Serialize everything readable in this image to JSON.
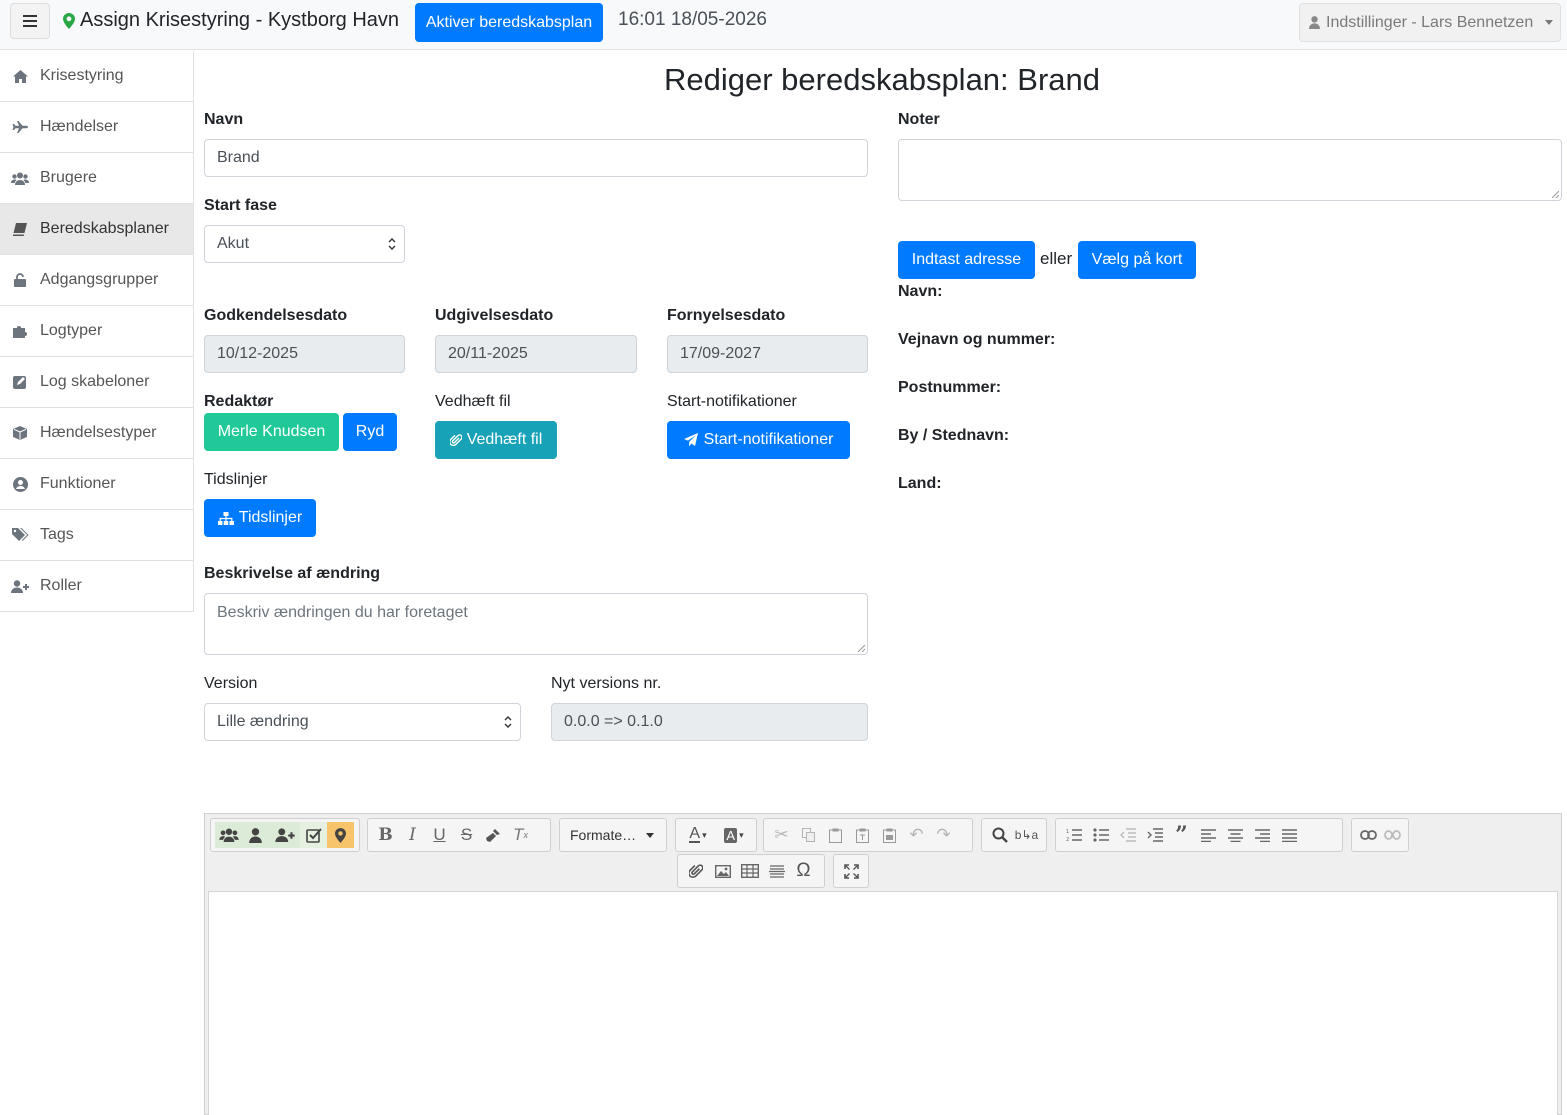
{
  "header": {
    "app_title": "Assign Krisestyring - Kystborg Havn",
    "activate_button": "Aktiver beredskabsplan",
    "datetime": "16:01 18/05-2026",
    "settings_label": "Indstillinger - Lars Bennetzen"
  },
  "sidebar": {
    "items": [
      {
        "label": "Krisestyring",
        "icon": "home-icon"
      },
      {
        "label": "Hændelser",
        "icon": "plane-icon"
      },
      {
        "label": "Brugere",
        "icon": "users-icon"
      },
      {
        "label": "Beredskabsplaner",
        "icon": "book-icon",
        "active": true
      },
      {
        "label": "Adgangsgrupper",
        "icon": "unlock-icon"
      },
      {
        "label": "Logtyper",
        "icon": "puzzle-icon"
      },
      {
        "label": "Log skabeloner",
        "icon": "edit-icon"
      },
      {
        "label": "Hændelsestyper",
        "icon": "cube-icon"
      },
      {
        "label": "Funktioner",
        "icon": "user-circle-icon"
      },
      {
        "label": "Tags",
        "icon": "tags-icon"
      },
      {
        "label": "Roller",
        "icon": "user-plus-icon"
      }
    ]
  },
  "page": {
    "title": "Rediger beredskabsplan: Brand"
  },
  "form": {
    "name_label": "Navn",
    "name_value": "Brand",
    "start_phase_label": "Start fase",
    "start_phase_value": "Akut",
    "approval_label": "Godkendelsesdato",
    "approval_value": "10/12-2025",
    "release_label": "Udgivelsesdato",
    "release_value": "20/11-2025",
    "renewal_label": "Fornyelsesdato",
    "renewal_value": "17/09-2027",
    "editor_label": "Redaktør",
    "editor_name": "Merle Knudsen",
    "clear_button": "Ryd",
    "attach_label": "Vedhæft fil",
    "attach_button": "Vedhæft fil",
    "notif_label": "Start-notifikationer",
    "notif_button": "Start-notifikationer",
    "timelines_label": "Tidslinjer",
    "timelines_button": "Tidslinjer",
    "change_label": "Beskrivelse af ændring",
    "change_placeholder": "Beskriv ændringen du har foretaget",
    "version_label": "Version",
    "version_value": "Lille ændring",
    "new_version_label": "Nyt versions nr.",
    "new_version_value": "0.0.0 => 0.1.0"
  },
  "right": {
    "notes_label": "Noter",
    "notes_value": "",
    "enter_address_button": "Indtast adresse",
    "or_text": "eller",
    "choose_map_button": "Vælg på kort",
    "address_fields": [
      "Navn:",
      "Vejnavn og nummer:",
      "Postnummer:",
      "By / Stednavn:",
      "Land:"
    ]
  },
  "toolbar": {
    "format_label": "Formate…"
  },
  "colors": {
    "primary": "#007bff",
    "info": "#17a2b8",
    "success": "#20c997",
    "pin": "#28a745"
  }
}
